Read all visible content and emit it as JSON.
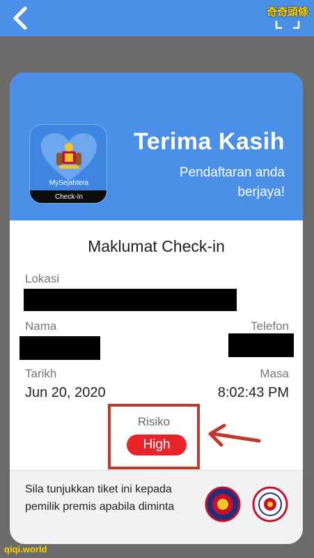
{
  "watermark": {
    "top": "奇奇頭條",
    "bottom": "qiqi.world"
  },
  "app": {
    "name": "MySejahtera",
    "badge": "Check-In"
  },
  "header": {
    "title": "Terima Kasih",
    "subtitle": "Pendaftaran anda berjaya!"
  },
  "checkin": {
    "title": "Maklumat Check-in",
    "location_label": "Lokasi",
    "name_label": "Nama",
    "phone_label": "Telefon",
    "date_label": "Tarikh",
    "date_value": "Jun 20, 2020",
    "time_label": "Masa",
    "time_value": "8:02:43 PM",
    "risk_label": "Risiko",
    "risk_value": "High"
  },
  "footer": {
    "instruction": "Sila tunjukkan tiket ini kepada pemilik premis apabila diminta"
  },
  "colors": {
    "primary": "#4a8fe8",
    "risk_high": "#e8232a",
    "annotation": "#c0392b"
  },
  "icons": [
    "back-arrow-icon",
    "qr-scan-icon",
    "checkmark-icon",
    "app-heart-icon",
    "government-crest-icon",
    "annotation-arrow-icon",
    "mkn-seal-icon",
    "kkm-seal-icon"
  ]
}
